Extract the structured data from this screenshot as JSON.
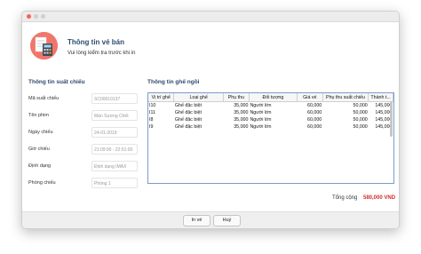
{
  "header": {
    "title": "Thông tin vé bán",
    "subtitle": "Vui lòng kiểm tra trước khi in"
  },
  "showtime_section": {
    "title": "Thông tin suất chiếu",
    "fields": [
      {
        "label": "Mã suất chiếu",
        "value": "SC00010137"
      },
      {
        "label": "Tên phim",
        "value": "Màn Sương Chết"
      },
      {
        "label": "Ngày chiếu",
        "value": "24-01-2019"
      },
      {
        "label": "Giờ chiếu",
        "value": "21:09:00 - 22:51:00"
      },
      {
        "label": "Định dạng",
        "value": "Định dạng IMAX"
      },
      {
        "label": "Phòng  chiếu",
        "value": "Phòng 1"
      }
    ]
  },
  "seat_section": {
    "title": "Thông tin ghế ngồi",
    "columns": [
      "Vị trí ghế",
      "Loại ghế",
      "Phụ thu",
      "Đối tượng",
      "Giá vé",
      "Phụ thu suất chiếu",
      "Thành t..."
    ],
    "rows": [
      [
        "I10",
        "Ghế đặc biệt",
        "35,000",
        "Người lớn",
        "60,000",
        "50,000",
        "145,000"
      ],
      [
        "I11",
        "Ghế đặc biệt",
        "35,000",
        "Người lớn",
        "60,000",
        "50,000",
        "145,000"
      ],
      [
        "I8",
        "Ghế đặc biệt",
        "35,000",
        "Người lớn",
        "60,000",
        "50,000",
        "145,000"
      ],
      [
        "I9",
        "Ghế đặc biệt",
        "35,000",
        "Người lớn",
        "60,000",
        "50,000",
        "145,000"
      ]
    ]
  },
  "total": {
    "label": "Tổng cộng",
    "value": "580,000 VND"
  },
  "footer": {
    "print_label": "In vé",
    "cancel_label": "Huỷ"
  },
  "colors": {
    "accent": "#2d4a6e",
    "total": "#d22a2a",
    "logo": "#f0766b"
  }
}
